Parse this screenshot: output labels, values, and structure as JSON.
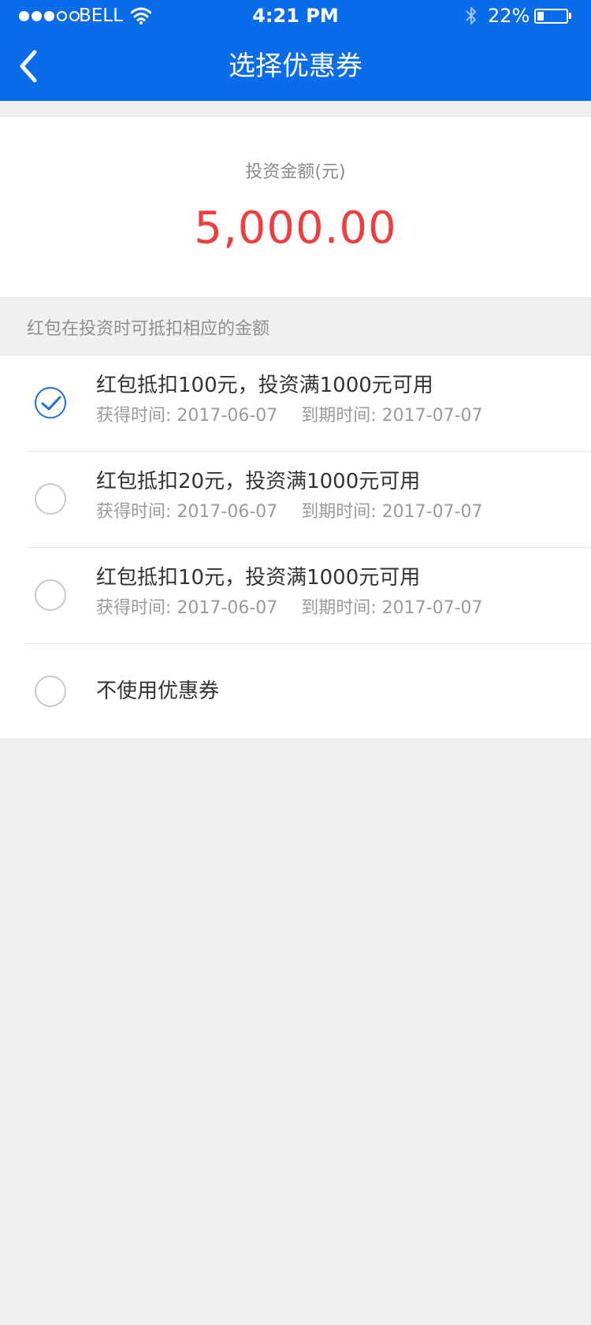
{
  "status_bar": {
    "carrier": "BELL",
    "time": "4:21 PM",
    "battery": "22%",
    "battery_level": 0.22,
    "signal_bars_filled": 3,
    "signal_bars_total": 5
  },
  "nav": {
    "title": "选择优惠券",
    "back_icon": "chevron-left-icon"
  },
  "investment": {
    "label": "投资金额(元)",
    "amount": "5,000.00",
    "amount_color": "#f03d3d"
  },
  "hint": "红包在投资时可抵扣相应的金额",
  "coupons": [
    {
      "title": "红包抵扣100元，投资满1000元可用",
      "obtained": "获得时间: 2017-06-07",
      "expires": "到期时间: 2017-07-07",
      "selected": true
    },
    {
      "title": "红包抵扣20元，投资满1000元可用",
      "obtained": "获得时间: 2017-06-07",
      "expires": "到期时间: 2017-07-07",
      "selected": false
    },
    {
      "title": "红包抵扣10元，投资满1000元可用",
      "obtained": "获得时间: 2017-06-07",
      "expires": "到期时间: 2017-07-07",
      "selected": false
    }
  ],
  "no_coupon": {
    "label": "不使用优惠券",
    "selected": false
  },
  "colors": {
    "header": "#0a6ce8",
    "accent": "#1c6fe0",
    "background": "#f0f0f0"
  }
}
